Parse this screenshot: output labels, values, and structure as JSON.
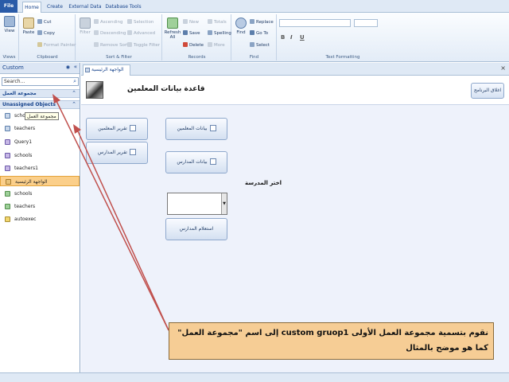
{
  "ribbon_tabs": [
    "File",
    "Home",
    "Create",
    "External Data",
    "Database Tools"
  ],
  "ribbon": {
    "views": {
      "label": "Views",
      "view": "View"
    },
    "clipboard": {
      "label": "Clipboard",
      "paste": "Paste",
      "cut": "Cut",
      "copy": "Copy",
      "format_painter": "Format Painter"
    },
    "sort_filter": {
      "label": "Sort & Filter",
      "filter": "Filter",
      "ascending": "Ascending",
      "descending": "Descending",
      "remove_sort": "Remove Sort",
      "selection": "Selection",
      "advanced": "Advanced",
      "toggle_filter": "Toggle Filter"
    },
    "records": {
      "label": "Records",
      "refresh": "Refresh All",
      "new": "New",
      "save": "Save",
      "delete": "Delete",
      "totals": "Totals",
      "spelling": "Spelling",
      "more": "More"
    },
    "find": {
      "label": "Find",
      "find": "Find",
      "replace": "Replace",
      "goto": "Go To",
      "select": "Select"
    },
    "text_formatting": {
      "label": "Text Formatting",
      "bold": "B",
      "italic": "I",
      "underline": "U"
    }
  },
  "nav": {
    "title": "Custom",
    "search_placeholder": "Search...",
    "group1": "مجموعة العمل",
    "group2": "Unassigned Objects",
    "tooltip": "مجموعة العمل",
    "items": [
      {
        "label": "schools",
        "type": "table"
      },
      {
        "label": "teachers",
        "type": "table"
      },
      {
        "label": "Query1",
        "type": "query"
      },
      {
        "label": "schools",
        "type": "query"
      },
      {
        "label": "teachers1",
        "type": "query"
      },
      {
        "label": "الواجهة الرئيسية",
        "type": "form",
        "selected": true
      },
      {
        "label": "schools",
        "type": "form"
      },
      {
        "label": "teachers",
        "type": "form"
      },
      {
        "label": "autoexec",
        "type": "macro"
      }
    ]
  },
  "document": {
    "tab_label": "الواجهة الرئيسية",
    "title": "قاعدة بيانات المعلمين",
    "exit_button": "اغلاق البرنامج",
    "buttons": {
      "teachers_report": "تقرير المعلمين",
      "schools_report": "تقرير المدارس",
      "teachers_data": "بيانات المعلمين",
      "schools_data": "بيانات المدارس",
      "choose_school": "اختر المدرسة",
      "school_query": "استعلام المدارس"
    }
  },
  "annotation": {
    "text": "نقوم بتسمية مجموعة العمل الأولى custom gruop1 إلى اسم \"مجموعة العمل\" كما هو موضح بالمثال"
  },
  "colors": {
    "accent": "#2a5ba8",
    "callout_bg": "#f6cd95",
    "arrow": "#c0504d",
    "selected_item": "#fbcf8a"
  }
}
